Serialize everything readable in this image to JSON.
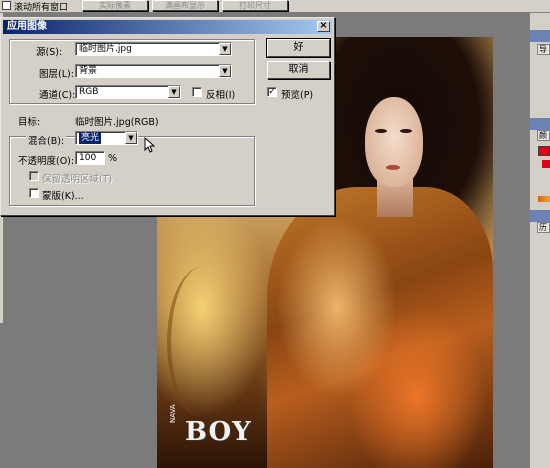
{
  "options_bar": {
    "checkbox_label": "滚动所有窗口",
    "buttons": [
      "实际像素",
      "满画布显示",
      "打印尺寸"
    ]
  },
  "dialog": {
    "title": "应用图像",
    "source": {
      "label": "源(S):",
      "value": "临时图片.jpg"
    },
    "layer": {
      "label": "图层(L):",
      "value": "背景"
    },
    "channel": {
      "label": "通道(C):",
      "value": "RGB",
      "invert_label": "反相(I)"
    },
    "target": {
      "label": "目标:",
      "value": "临时图片.jpg(RGB)"
    },
    "blending": {
      "label": "混合(B):",
      "value": "亮光"
    },
    "opacity": {
      "label": "不透明度(O):",
      "value": "100",
      "unit": "%"
    },
    "preserve_transparency": {
      "label": "保留透明区域(T)",
      "checked": false,
      "enabled": false
    },
    "mask": {
      "label": "蒙版(K)...",
      "checked": false
    },
    "ok_label": "好",
    "cancel_label": "取消",
    "preview": {
      "label": "预览(P)",
      "checked": true
    }
  },
  "palettes": {
    "tabs": [
      "导",
      "颜",
      "历"
    ],
    "swatch_color": "#e0001a"
  },
  "image": {
    "logo_text": "BOY",
    "logo_small": "NAVA"
  }
}
